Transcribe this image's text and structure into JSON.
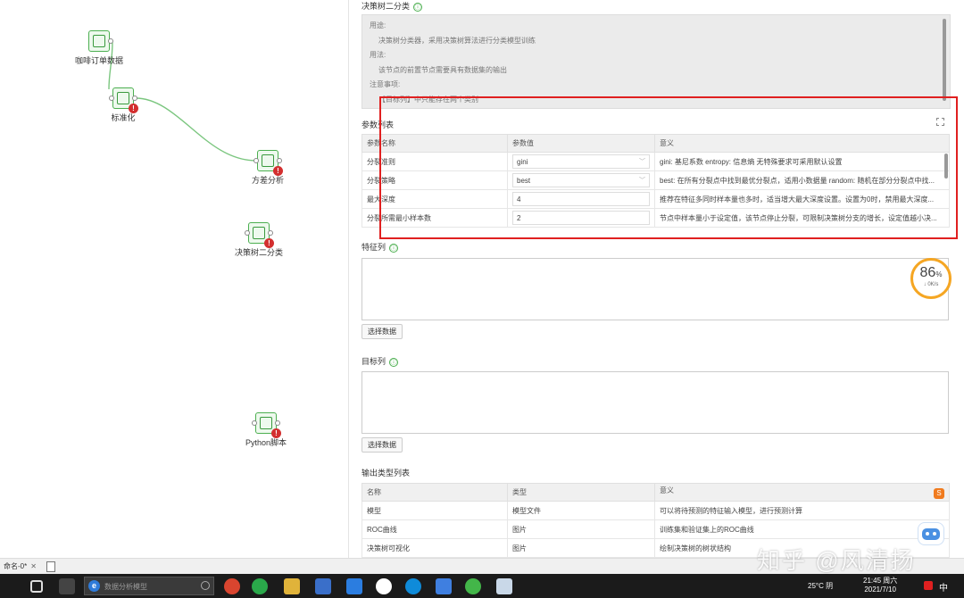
{
  "canvas": {
    "nodes": [
      {
        "name": "node-coffee-orders",
        "label": "咖啡订单数据",
        "warn": false
      },
      {
        "name": "node-normalize",
        "label": "标准化",
        "warn": true
      },
      {
        "name": "node-variance",
        "label": "方差分析",
        "warn": true
      },
      {
        "name": "node-decision-tree",
        "label": "决策树二分类",
        "warn": true
      },
      {
        "name": "node-python",
        "label": "Python脚本",
        "warn": true
      }
    ]
  },
  "panel": {
    "title": "决策树二分类",
    "info_icon": "ⓘ",
    "description": {
      "usage_heading": "用途:",
      "usage_text": "决策树分类器，采用决策树算法进行分类模型训练",
      "method_heading": "用法:",
      "method_text": "该节点的前置节点需要具有数据集的输出",
      "notes_heading": "注意事项:",
      "notes_text": "【目标列】中只能存在两个类别"
    },
    "params": {
      "label": "参数列表",
      "headers": [
        "参数名称",
        "参数值",
        "意义"
      ],
      "rows": [
        {
          "name": "分裂准则",
          "value": "gini",
          "dropdown": true,
          "meaning": "gini: 基尼系数 entropy: 信息熵 无特殊要求可采用默认设置"
        },
        {
          "name": "分裂策略",
          "value": "best",
          "dropdown": true,
          "meaning": "best: 在所有分裂点中找到最优分裂点，适用小数据量 random: 随机在部分分裂点中找..."
        },
        {
          "name": "最大深度",
          "value": "4",
          "dropdown": false,
          "meaning": "推荐在特征多同时样本量也多时，适当增大最大深度设置。设置为0时，禁用最大深度..."
        },
        {
          "name": "分裂所需最小样本数",
          "value": "2",
          "dropdown": false,
          "meaning": "节点中样本量小于设定值，该节点停止分裂，可限制决策树分支的增长，设定值越小决..."
        }
      ]
    },
    "feature_cols": {
      "label": "特征列",
      "button": "选择数据"
    },
    "target_col": {
      "label": "目标列",
      "button": "选择数据"
    },
    "outputs": {
      "label": "输出类型列表",
      "headers": [
        "名称",
        "类型",
        "意义"
      ],
      "rows": [
        {
          "name": "模型",
          "type": "模型文件",
          "meaning": "可以将待预测的特征输入模型，进行预测计算"
        },
        {
          "name": "ROC曲线",
          "type": "图片",
          "meaning": "训练集和验证集上的ROC曲线"
        },
        {
          "name": "决策树可视化",
          "type": "图片",
          "meaning": "绘制决策树的树状结构"
        }
      ]
    }
  },
  "overlay": {
    "gauge_percent": "86",
    "gauge_unit": "%",
    "gauge_speed": "↓ 0K/s",
    "watermark": "知乎 @风清扬",
    "highlight_color": "#e02020"
  },
  "tabbar": {
    "tab_label": "命名-0*",
    "close": "✕"
  },
  "taskbar": {
    "search_placeholder": "数据分析模型",
    "weather": "25°C 阴",
    "time": "21:45 周六",
    "date": "2021/7/10",
    "lang": "中"
  }
}
